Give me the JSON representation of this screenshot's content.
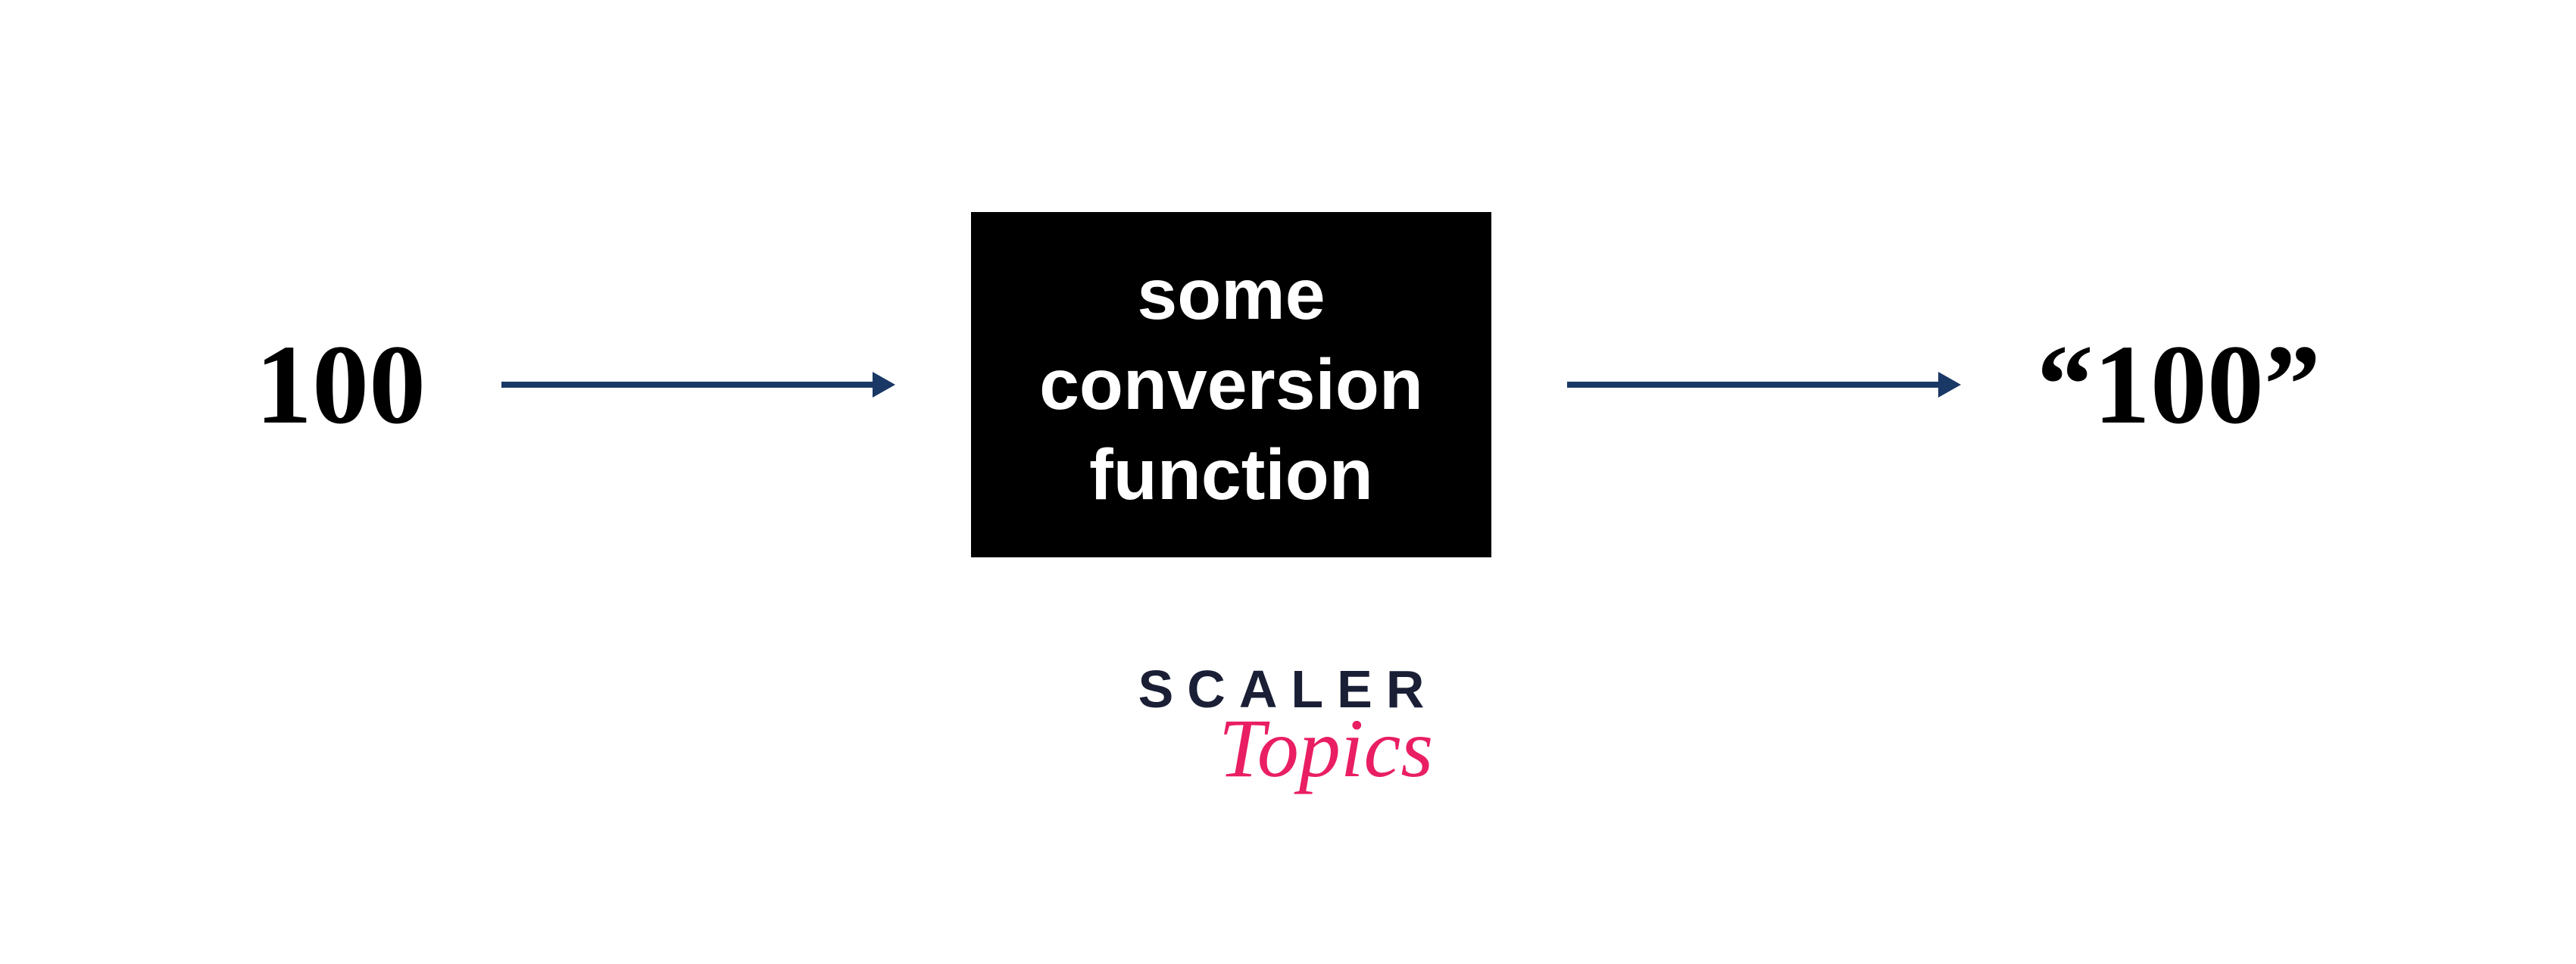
{
  "diagram": {
    "input": "100",
    "box_line1": "some",
    "box_line2": "conversion",
    "box_line3": "function",
    "output": "“100”"
  },
  "logo": {
    "line1": "SCALER",
    "line2": "Topics"
  },
  "colors": {
    "arrow": "#1a3866",
    "box_bg": "#000000",
    "box_text": "#ffffff",
    "logo_dark": "#1a1f36",
    "logo_accent": "#e91e63"
  }
}
